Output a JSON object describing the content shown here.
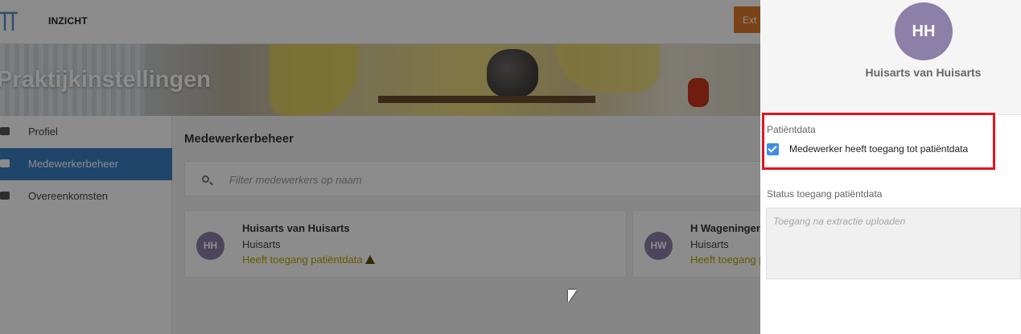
{
  "app": {
    "name": "INZICHT",
    "extract_button": "Ext"
  },
  "hero": {
    "title": "Praktijkinstellingen"
  },
  "sidebar": {
    "items": [
      {
        "label": "Profiel",
        "icon": "id-card-icon"
      },
      {
        "label": "Medewerkerbeheer",
        "icon": "users-icon",
        "active": true
      },
      {
        "label": "Overeenkomsten",
        "icon": "folder-icon"
      }
    ]
  },
  "main": {
    "section_title": "Medewerkerbeheer",
    "filter_placeholder": "Filter medewerkers op naam",
    "cards": [
      {
        "initials": "HH",
        "name": "Huisarts van Huisarts",
        "role": "Huisarts",
        "status": "Heeft toegang patiëntdata"
      },
      {
        "initials": "HW",
        "name": "H Wageningen",
        "role": "Huisarts",
        "status": "Heeft toegang p"
      }
    ]
  },
  "drawer": {
    "avatar_initials": "HH",
    "name": "Huisarts van Huisarts",
    "patientdata_label": "Patiëntdata",
    "checkbox_label": "Medewerker heeft toegang tot patiëntdata",
    "checkbox_checked": true,
    "status_label": "Status toegang patiëntdata",
    "status_placeholder": "Toegang na extractie uploaden"
  },
  "colors": {
    "accent": "#3a7fc4",
    "avatar": "#8c7fa8",
    "highlight": "#e3141f",
    "status_text": "#b9a100",
    "extract_button": "#e0792a"
  }
}
